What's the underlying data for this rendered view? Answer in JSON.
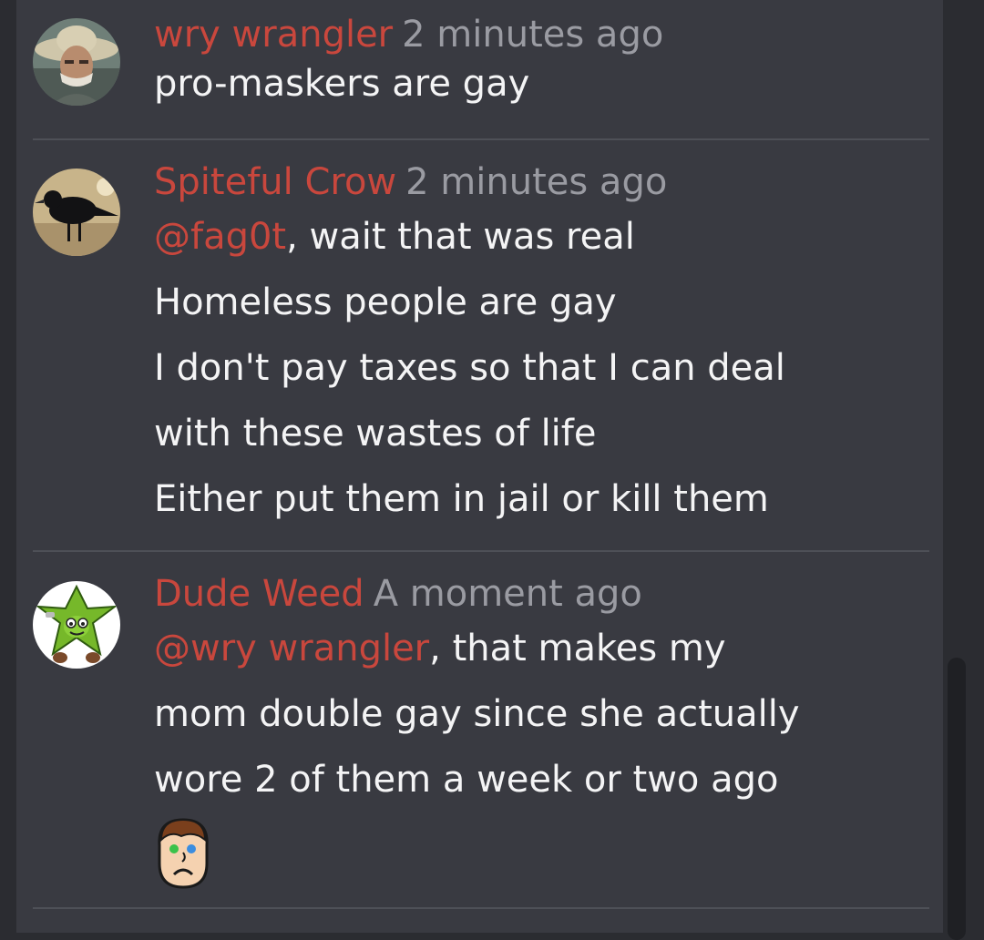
{
  "comments": [
    {
      "username": "wry wrangler",
      "time": "2 minutes ago",
      "lines": [
        "pro-maskers are gay"
      ]
    },
    {
      "username": "Spiteful Crow",
      "time": "2 minutes ago",
      "mention": "@fag0t",
      "mention_rest": ", wait that was real",
      "lines": [
        "Homeless people are gay",
        "I don't pay taxes so that I can deal",
        "with these wastes of life",
        "Either put them in jail or kill them"
      ]
    },
    {
      "username": "Dude Weed",
      "time": "A moment ago",
      "mention": "@wry wrangler",
      "mention_rest": ", that makes my",
      "lines": [
        "mom double gay since she actually",
        "wore 2 of them a week or two ago"
      ],
      "emoji": "sad-face-emoji"
    }
  ],
  "colors": {
    "username": "#c9473d",
    "timestamp": "#9a9ba2",
    "text": "#f4f4f5",
    "panel": "#393a41",
    "background": "#2b2c31"
  }
}
